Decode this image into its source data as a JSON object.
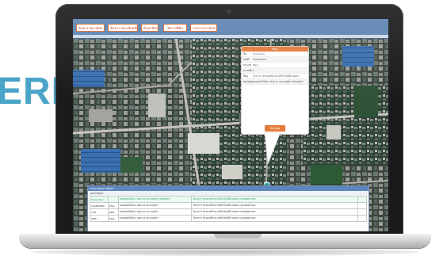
{
  "headline_text": "ERE",
  "toolbar": {
    "tabs": [
      "ค้นหารายละเอียด",
      "ค้นหารายละเอียดที่ดิน",
      "ค้นหาพิกัด",
      "จัดการที่ดิน",
      "รายงานการค้นหา"
    ]
  },
  "popup": {
    "title": "ข้อมูล",
    "rows": [
      {
        "label": "ชื่อ",
        "value": "Tomsonline"
      },
      {
        "label": "เลขที่",
        "value": "0000000000"
      },
      {
        "label": "ประเภท",
        "value": "Plain"
      },
      {
        "label": "ความคืบ",
        "value": "0"
      },
      {
        "label": "ที่อยู่",
        "value": "โครงการ บ้านเลขที่ และรหัสไปรษณีย์ 10000"
      },
      {
        "label": "หมายเหตุ",
        "value": "ถนนพหลโยธิน 2 ซอย 24 แขวงจตุจักร เขตจตุจักร"
      }
    ],
    "button_label": "เพิ่มข้อมูล"
  },
  "panel": {
    "title": "รายงานผลการค้นหา",
    "subtitle": "ผลการค้นหา",
    "rows": [
      [
        "Tomsonline",
        "",
        "ถนนพหลโยธิน 2 ซอย 24 แขวงจตุจักร เขตจตุจักร",
        "โครงการ บ้านเลขที่ และรหัสไปรษณีย์ 10000 กรุงเทพมหานคร",
        ""
      ],
      [
        "1234567890",
        "Plain",
        "ถนนพหลโยธิน 2 ซอย 24 แขวงจตุจักร",
        "โครงการ บ้านเลขที่ และรหัสไปรษณีย์ 10000 กรุงเทพมหานคร",
        ""
      ],
      [
        "TPD",
        "RED",
        "ถนนพหลโยธิน 2 ซอย 24 แขวงจตุจักร",
        "โครงการ บ้านเลขที่ และรหัสไปรษณีย์ 10000 กรุงเทพมหานคร",
        ""
      ],
      [
        "9090",
        "Plain",
        "ถนนพหลโยธิน 2 ซอย 24 แขวงจตุจักร",
        "โครงการ บ้านเลขที่ และรหัสไปรษณีย์ 10000 กรุงเทพมหานคร",
        ""
      ]
    ]
  },
  "colors": {
    "accent_orange": "#e57b3a",
    "toolbar_blue": "#5e84b1",
    "logo_blue": "#4aa3c8"
  }
}
